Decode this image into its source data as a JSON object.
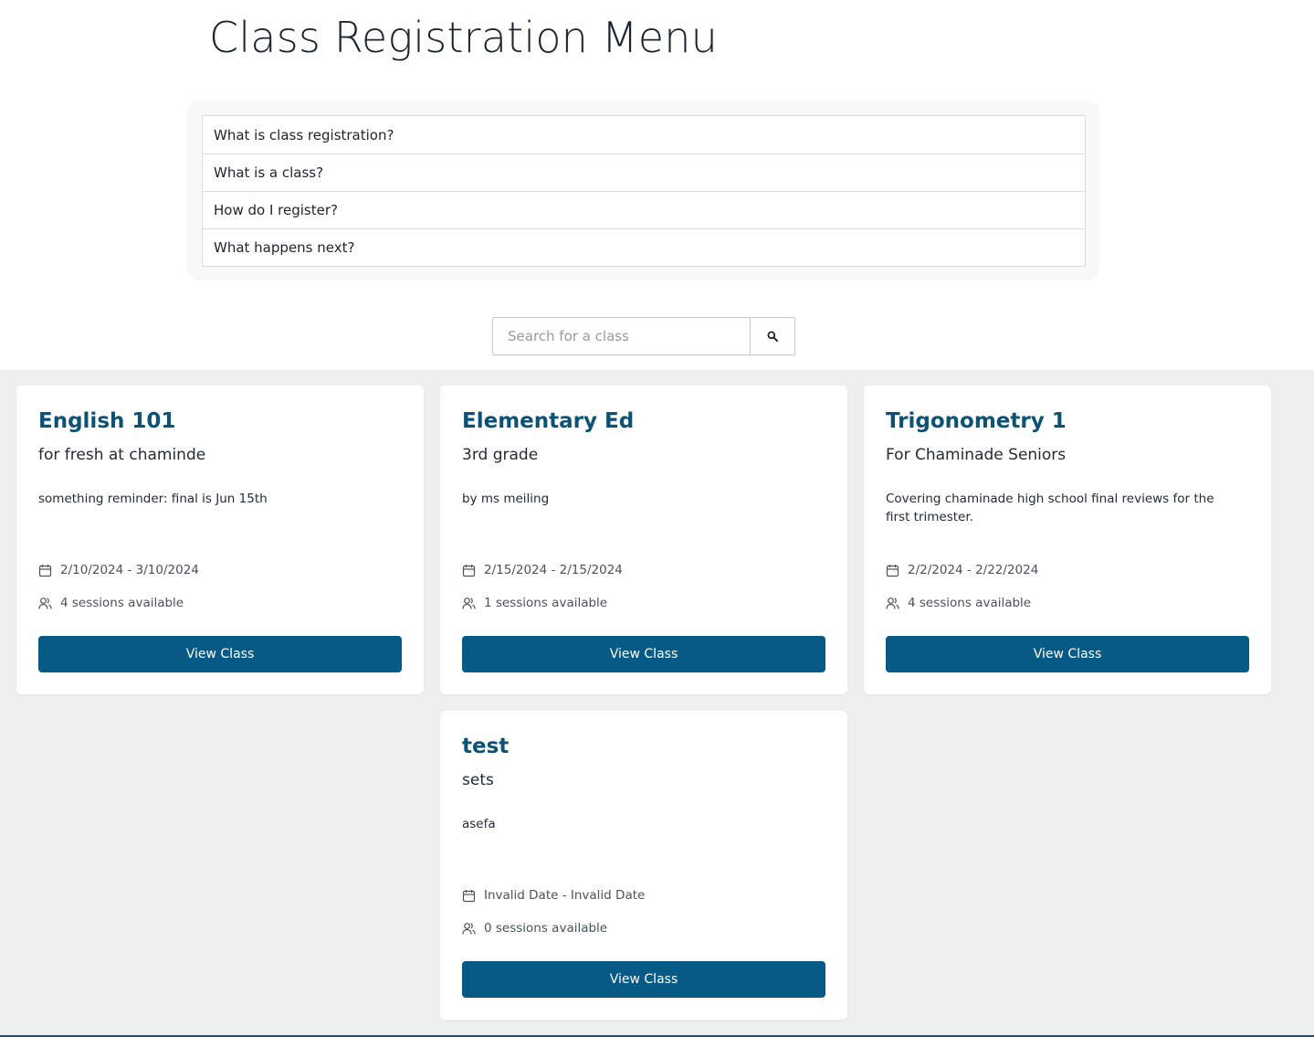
{
  "header": {
    "title": "Class Registration Menu"
  },
  "faq": {
    "items": [
      {
        "label": "What is class registration?"
      },
      {
        "label": "What is a class?"
      },
      {
        "label": "How do I register?"
      },
      {
        "label": "What happens next?"
      }
    ]
  },
  "search": {
    "placeholder": "Search for a class",
    "value": "",
    "button_icon": "search-icon"
  },
  "colors": {
    "accent": "#065a85",
    "title": "#0c5276",
    "background": "#eef0ef"
  },
  "classes": [
    {
      "title": "English 101",
      "subtitle": "for fresh at chaminde",
      "description": "something reminder: final is Jun 15th",
      "dates": "2/10/2024 - 3/10/2024",
      "sessions": "4 sessions available",
      "button": "View Class"
    },
    {
      "title": "Elementary Ed",
      "subtitle": "3rd grade",
      "description": "by ms meiling",
      "dates": "2/15/2024 - 2/15/2024",
      "sessions": "1 sessions available",
      "button": "View Class"
    },
    {
      "title": "Trigonometry 1",
      "subtitle": "For Chaminade Seniors",
      "description": "Covering chaminade high school final reviews for the first trimester.",
      "dates": "2/2/2024 - 2/22/2024",
      "sessions": "4 sessions available",
      "button": "View Class"
    },
    {
      "title": "test",
      "subtitle": "sets",
      "description": "asefa",
      "dates": "Invalid Date - Invalid Date",
      "sessions": "0 sessions available",
      "button": "View Class"
    }
  ]
}
